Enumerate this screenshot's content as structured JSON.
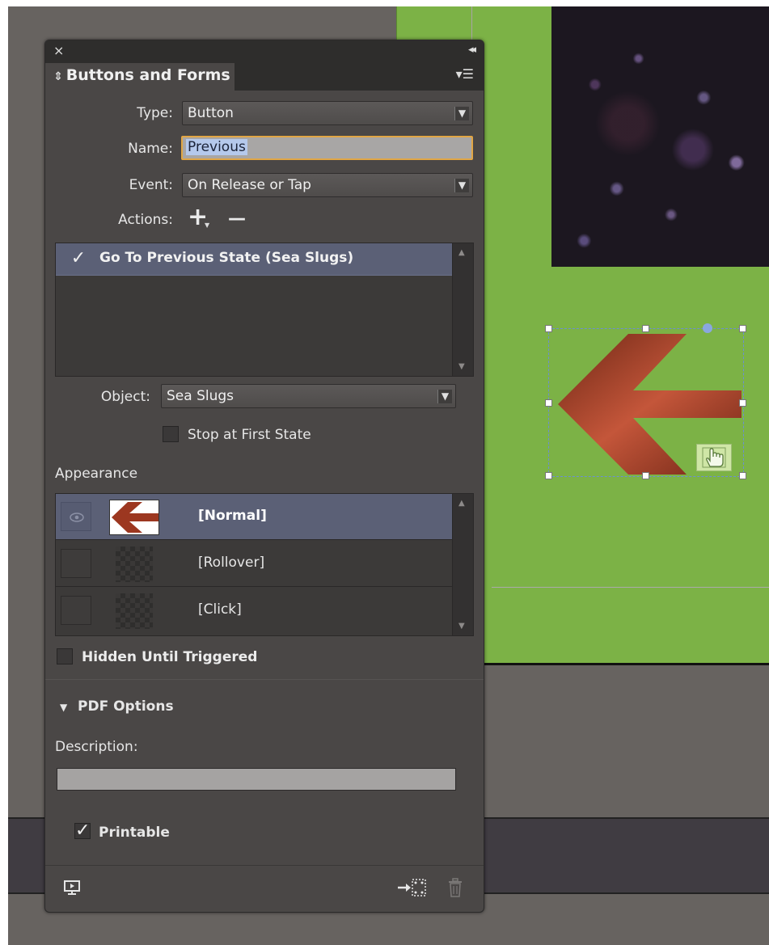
{
  "panel": {
    "close_glyph": "×",
    "collapse_glyph": "◂◂",
    "tab_title": "Buttons and Forms",
    "tab_updown_glyph": "⇕",
    "menu_glyph": "▾☰"
  },
  "form": {
    "type_label": "Type:",
    "type_value": "Button",
    "name_label": "Name:",
    "name_value": "Previous",
    "event_label": "Event:",
    "event_value": "On Release or Tap",
    "actions_label": "Actions:",
    "add_action_glyph": "+",
    "remove_action_glyph": "—"
  },
  "actions": {
    "items": [
      {
        "label": "Go To Previous State (Sea Slugs)",
        "checked": true
      }
    ]
  },
  "object": {
    "label": "Object:",
    "value": "Sea Slugs",
    "stop_at_first_state_label": "Stop at First State"
  },
  "appearance": {
    "heading": "Appearance",
    "states": [
      {
        "label": "[Normal]"
      },
      {
        "label": "[Rollover]"
      },
      {
        "label": "[Click]"
      }
    ]
  },
  "hidden_until_triggered_label": "Hidden Until Triggered",
  "pdf_options": {
    "heading": "PDF Options",
    "description_label": "Description:",
    "description_value": "",
    "printable_label": "Printable"
  },
  "colors": {
    "panel_bg": "#4a4746",
    "selection_row": "#5b6076",
    "page_green": "#7cb246",
    "arrow_red": "#a03a22",
    "focus_orange": "#e1a645"
  }
}
